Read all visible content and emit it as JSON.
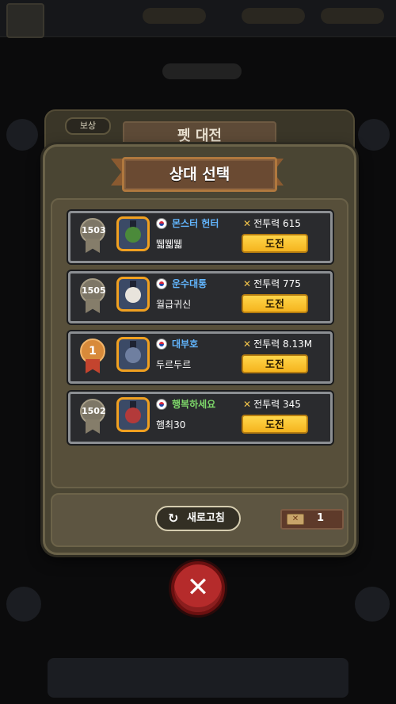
{
  "background": {
    "pet_battle_title": "펫 대전",
    "reward_tab": "보상"
  },
  "popup": {
    "title": "상대 선택",
    "challenge_label": "도전",
    "opponents": [
      {
        "rank": "1503",
        "medal": "silver",
        "guild": "몬스터 헌터",
        "guild_color": "#62b6ff",
        "name": "뛟뛟뛟",
        "power_label": "전투력",
        "power": "615"
      },
      {
        "rank": "1505",
        "medal": "silver",
        "guild": "운수대통",
        "guild_color": "#62b6ff",
        "name": "월급귀신",
        "power_label": "전투력",
        "power": "775"
      },
      {
        "rank": "1",
        "medal": "gold",
        "guild": "대부호",
        "guild_color": "#62b6ff",
        "name": "두르두르",
        "power_label": "전투력",
        "power": "8.13M"
      },
      {
        "rank": "1502",
        "medal": "silver",
        "guild": "행복하세요",
        "guild_color": "#7ed96a",
        "name": "햄최30",
        "power_label": "전투력",
        "power": "345"
      }
    ],
    "refresh_label": "새로고침",
    "ticket_count": "1"
  },
  "icons": {
    "refresh": "refresh-icon",
    "close": "close-icon",
    "power": "crossed-swords-icon",
    "ticket": "ticket-icon",
    "flag": "korea-flag-icon"
  }
}
